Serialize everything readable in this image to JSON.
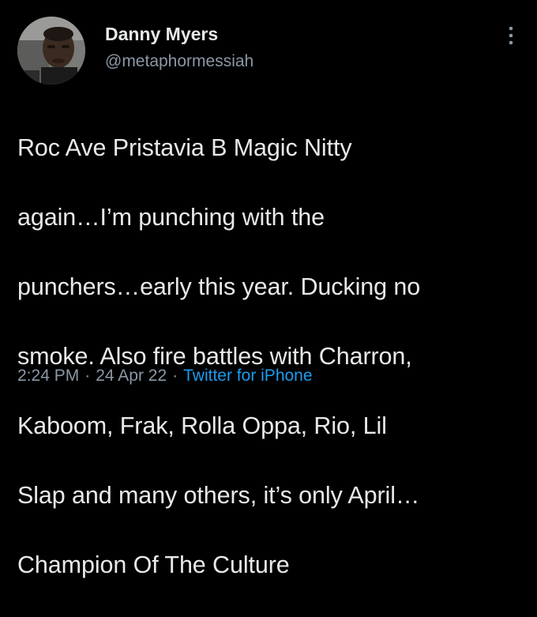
{
  "author": {
    "display_name": "Danny Myers",
    "handle": "@metaphormessiah",
    "avatar_icon": "user-avatar-photo"
  },
  "menu": {
    "icon": "more-vertical-icon"
  },
  "tweet": {
    "lines": [
      "Roc Ave Pristavia B Magic Nitty",
      "again…I’m punching with the",
      "punchers…early this year. Ducking no",
      "smoke. Also fire battles with Charron,",
      "Kaboom, Frak, Rolla Oppa, Rio, Lil",
      "Slap and many others, it’s only April…",
      "Champion Of The Culture"
    ]
  },
  "meta": {
    "time": "2:24 PM",
    "separator": "·",
    "date": "24 Apr 22",
    "source": "Twitter for iPhone"
  },
  "colors": {
    "background": "#000000",
    "text_primary": "#e7e9ea",
    "text_secondary": "#8b98a5",
    "link": "#1d9bf0"
  }
}
